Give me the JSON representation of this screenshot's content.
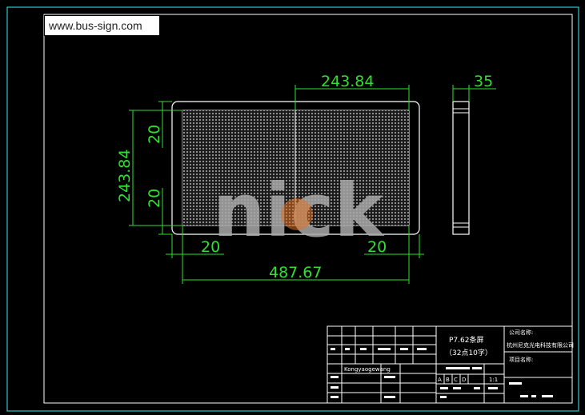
{
  "watermark": {
    "text": "www.bus-sign.com"
  },
  "logo": {
    "text": "nick"
  },
  "dimensions": {
    "top_width": "243.84",
    "side_depth": "35",
    "left_height": "243.84",
    "left_upper_margin": "20",
    "left_lower_margin": "20",
    "bottom_left_margin": "20",
    "bottom_right_margin": "20",
    "overall_width": "487.67"
  },
  "title_block": {
    "product_name": "P7.62条屏",
    "product_spec": "（32点10字）",
    "company_label": "公司名称:",
    "company_name": "杭州尼克光电科技有限公司",
    "project_label": "项目名称:",
    "designer": "Kongyaogewang",
    "scale_cells": [
      "A",
      "B",
      "C",
      "D"
    ],
    "scale": "1:1"
  },
  "colors": {
    "frame": "#2ec8c8",
    "dimension": "#2fe02f",
    "outline": "#ffffff",
    "logo_dot": "#e07020"
  }
}
